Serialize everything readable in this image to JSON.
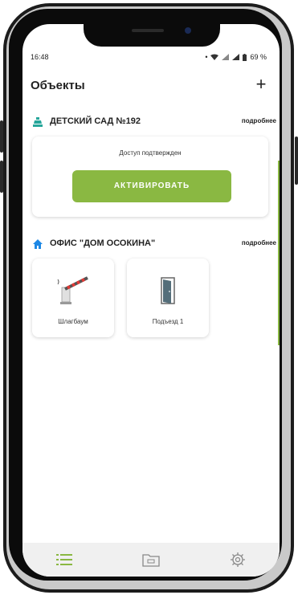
{
  "status_bar": {
    "time": "16:48",
    "battery": "69 %"
  },
  "header": {
    "title": "Объекты",
    "add_label": "+"
  },
  "objects": [
    {
      "name": "ДЕТСКИЙ САД №192",
      "more_label": "подробнее",
      "icon": "building-icon",
      "access_status": "Доступ подтвержден",
      "action_label": "АКТИВИРОВАТЬ"
    },
    {
      "name": "ОФИС \"ДОМ ОСОКИНА\"",
      "more_label": "подробнее",
      "icon": "home-icon",
      "devices": [
        {
          "label": "Шлагбаум",
          "icon": "barrier-icon"
        },
        {
          "label": "Подъезд 1",
          "icon": "door-icon"
        }
      ]
    }
  ],
  "bottom_nav": [
    "list-icon",
    "folder-icon",
    "gear-icon"
  ],
  "colors": {
    "accent": "#8ab842",
    "home_icon": "#1e88e5",
    "building_icon": "#26a69a"
  }
}
